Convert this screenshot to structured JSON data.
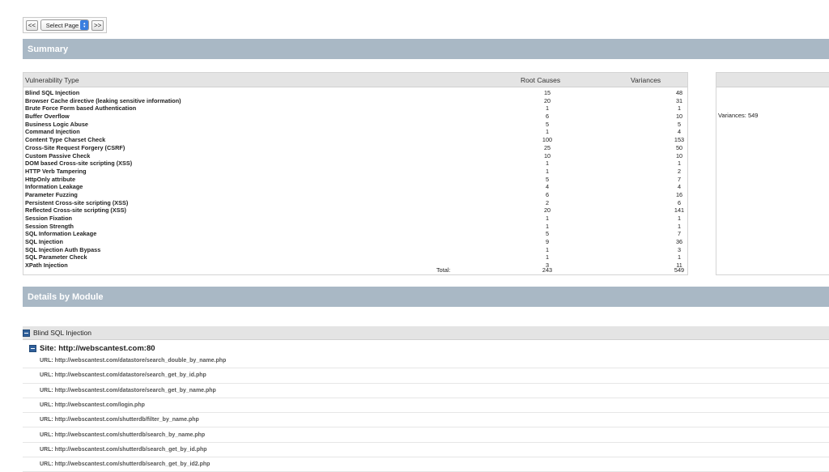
{
  "pager": {
    "prev_label": "<<",
    "select_value": "Select Page",
    "next_label": ">>"
  },
  "summary": {
    "title": "Summary",
    "headers": {
      "type": "Vulnerability Type",
      "root": "Root Causes",
      "var": "Variances"
    },
    "rows": [
      {
        "name": "Blind SQL Injection",
        "root": "15",
        "var": "48"
      },
      {
        "name": "Browser Cache directive (leaking sensitive information)",
        "root": "20",
        "var": "31"
      },
      {
        "name": "Brute Force Form based Authentication",
        "root": "1",
        "var": "1"
      },
      {
        "name": "Buffer Overflow",
        "root": "6",
        "var": "10"
      },
      {
        "name": "Business Logic Abuse",
        "root": "5",
        "var": "5"
      },
      {
        "name": "Command Injection",
        "root": "1",
        "var": "4"
      },
      {
        "name": "Content Type Charset Check",
        "root": "100",
        "var": "153"
      },
      {
        "name": "Cross-Site Request Forgery (CSRF)",
        "root": "25",
        "var": "50"
      },
      {
        "name": "Custom Passive Check",
        "root": "10",
        "var": "10"
      },
      {
        "name": "DOM based Cross-site scripting (XSS)",
        "root": "1",
        "var": "1"
      },
      {
        "name": "HTTP Verb Tampering",
        "root": "1",
        "var": "2"
      },
      {
        "name": "HttpOnly attribute",
        "root": "5",
        "var": "7"
      },
      {
        "name": "Information Leakage",
        "root": "4",
        "var": "4"
      },
      {
        "name": "Parameter Fuzzing",
        "root": "6",
        "var": "16"
      },
      {
        "name": "Persistent Cross-site scripting (XSS)",
        "root": "2",
        "var": "6"
      },
      {
        "name": "Reflected Cross-site scripting (XSS)",
        "root": "20",
        "var": "141"
      },
      {
        "name": "Session Fixation",
        "root": "1",
        "var": "1"
      },
      {
        "name": "Session Strength",
        "root": "1",
        "var": "1"
      },
      {
        "name": "SQL Information Leakage",
        "root": "5",
        "var": "7"
      },
      {
        "name": "SQL Injection",
        "root": "9",
        "var": "36"
      },
      {
        "name": "SQL Injection Auth Bypass",
        "root": "1",
        "var": "3"
      },
      {
        "name": "SQL Parameter Check",
        "root": "1",
        "var": "1"
      },
      {
        "name": "XPath Injection",
        "root": "3",
        "var": "11"
      }
    ],
    "total_label": "Total:",
    "total_root": "243",
    "total_var": "549",
    "side_variances": "Variances: 549"
  },
  "details": {
    "title": "Details by Module",
    "module": "Blind SQL Injection",
    "site": "Site: http://webscantest.com:80",
    "urls": [
      "URL: http://webscantest.com/datastore/search_double_by_name.php",
      "URL: http://webscantest.com/datastore/search_get_by_id.php",
      "URL: http://webscantest.com/datastore/search_get_by_name.php",
      "URL: http://webscantest.com/login.php",
      "URL: http://webscantest.com/shutterdb/filter_by_name.php",
      "URL: http://webscantest.com/shutterdb/search_by_name.php",
      "URL: http://webscantest.com/shutterdb/search_get_by_id.php",
      "URL: http://webscantest.com/shutterdb/search_get_by_id2.php"
    ]
  }
}
